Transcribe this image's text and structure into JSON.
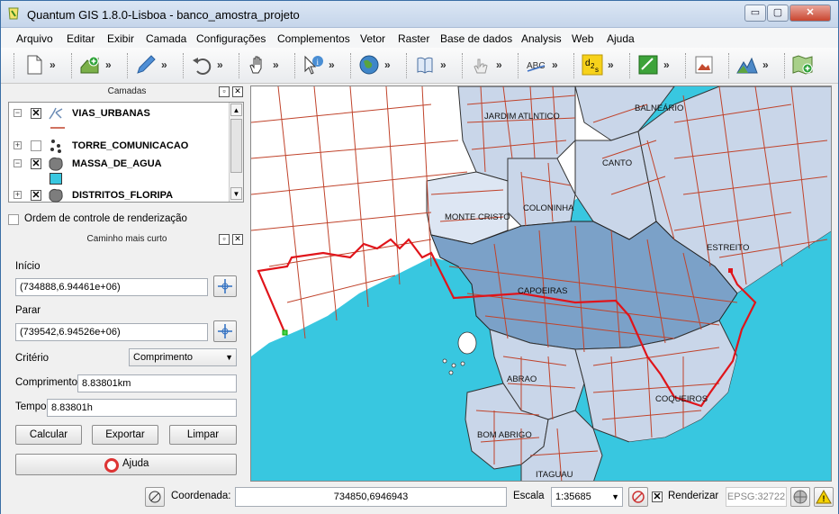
{
  "window": {
    "title": "Quantum GIS 1.8.0-Lisboa - banco_amostra_projeto",
    "min_label": "▭",
    "max_label": "▢",
    "close_label": "✕"
  },
  "menu": [
    "Arquivo",
    "Editar",
    "Exibir",
    "Camada",
    "Configurações",
    "Complementos",
    "Vetor",
    "Raster",
    "Base de dados",
    "Analysis",
    "Web",
    "Ajuda"
  ],
  "toolbar": {
    "more": "»",
    "icons": [
      "new-project-icon",
      "add-layer-icon",
      "digitize-pencil-icon",
      "undo-icon",
      "pan-hand-icon",
      "identify-icon",
      "globe-icon",
      "help-book-icon",
      "touch-icon",
      "label-abc-icon",
      "d2s-plugin-icon",
      "green-plugin-icon",
      "image-plugin-icon",
      "terrain-icon",
      "add-map-icon"
    ]
  },
  "layers_panel": {
    "title": "Camadas",
    "layers": [
      {
        "name": "VIAS_URBANAS",
        "checked": true,
        "expanded": true,
        "icon": "line-layer-icon"
      },
      {
        "name": "TORRE_COMUNICACAO",
        "checked": false,
        "expanded": false,
        "icon": "point-layer-icon"
      },
      {
        "name": "MASSA_DE_AGUA",
        "checked": true,
        "expanded": true,
        "icon": "polygon-layer-icon"
      },
      {
        "name": "DISTRITOS_FLORIPA",
        "checked": true,
        "expanded": false,
        "icon": "polygon-layer-icon"
      }
    ],
    "render_order_label": "Ordem de controle de renderização"
  },
  "route_panel": {
    "title": "Caminho mais curto",
    "start_label": "Início",
    "start_value": "(734888,6.94461e+06)",
    "stop_label": "Parar",
    "stop_value": "(739542,6.94526e+06)",
    "criterion_label": "Critério",
    "criterion_value": "Comprimento",
    "length_label": "Comprimento",
    "length_value": "8.83801km",
    "time_label": "Tempo",
    "time_value": "8.83801h",
    "calc_button": "Calcular",
    "export_button": "Exportar",
    "clear_button": "Limpar",
    "help_button": "Ajuda"
  },
  "map": {
    "districts": [
      "JARDIM ATLNTICO",
      "BALNEÁRIO",
      "CANTO",
      "MONTE CRISTO",
      "COLONINHA",
      "ESTREITO",
      "CAPOEIRAS",
      "ABRAO",
      "COQUEIROS",
      "BOM ABRIGO",
      "ITAGUAU"
    ],
    "colors": {
      "water": "#38c7e0",
      "land": "#ffffff",
      "district": "#c9d6e9",
      "selected": "#7ba1c8",
      "road": "#c0432b",
      "route": "#e0141a"
    }
  },
  "status": {
    "coord_label": "Coordenada:",
    "coord_value": "734850,6946943",
    "scale_label": "Escala",
    "scale_value": "1:35685",
    "render_label": "Renderizar",
    "render_checked": true,
    "epsg": "EPSG:32722"
  }
}
